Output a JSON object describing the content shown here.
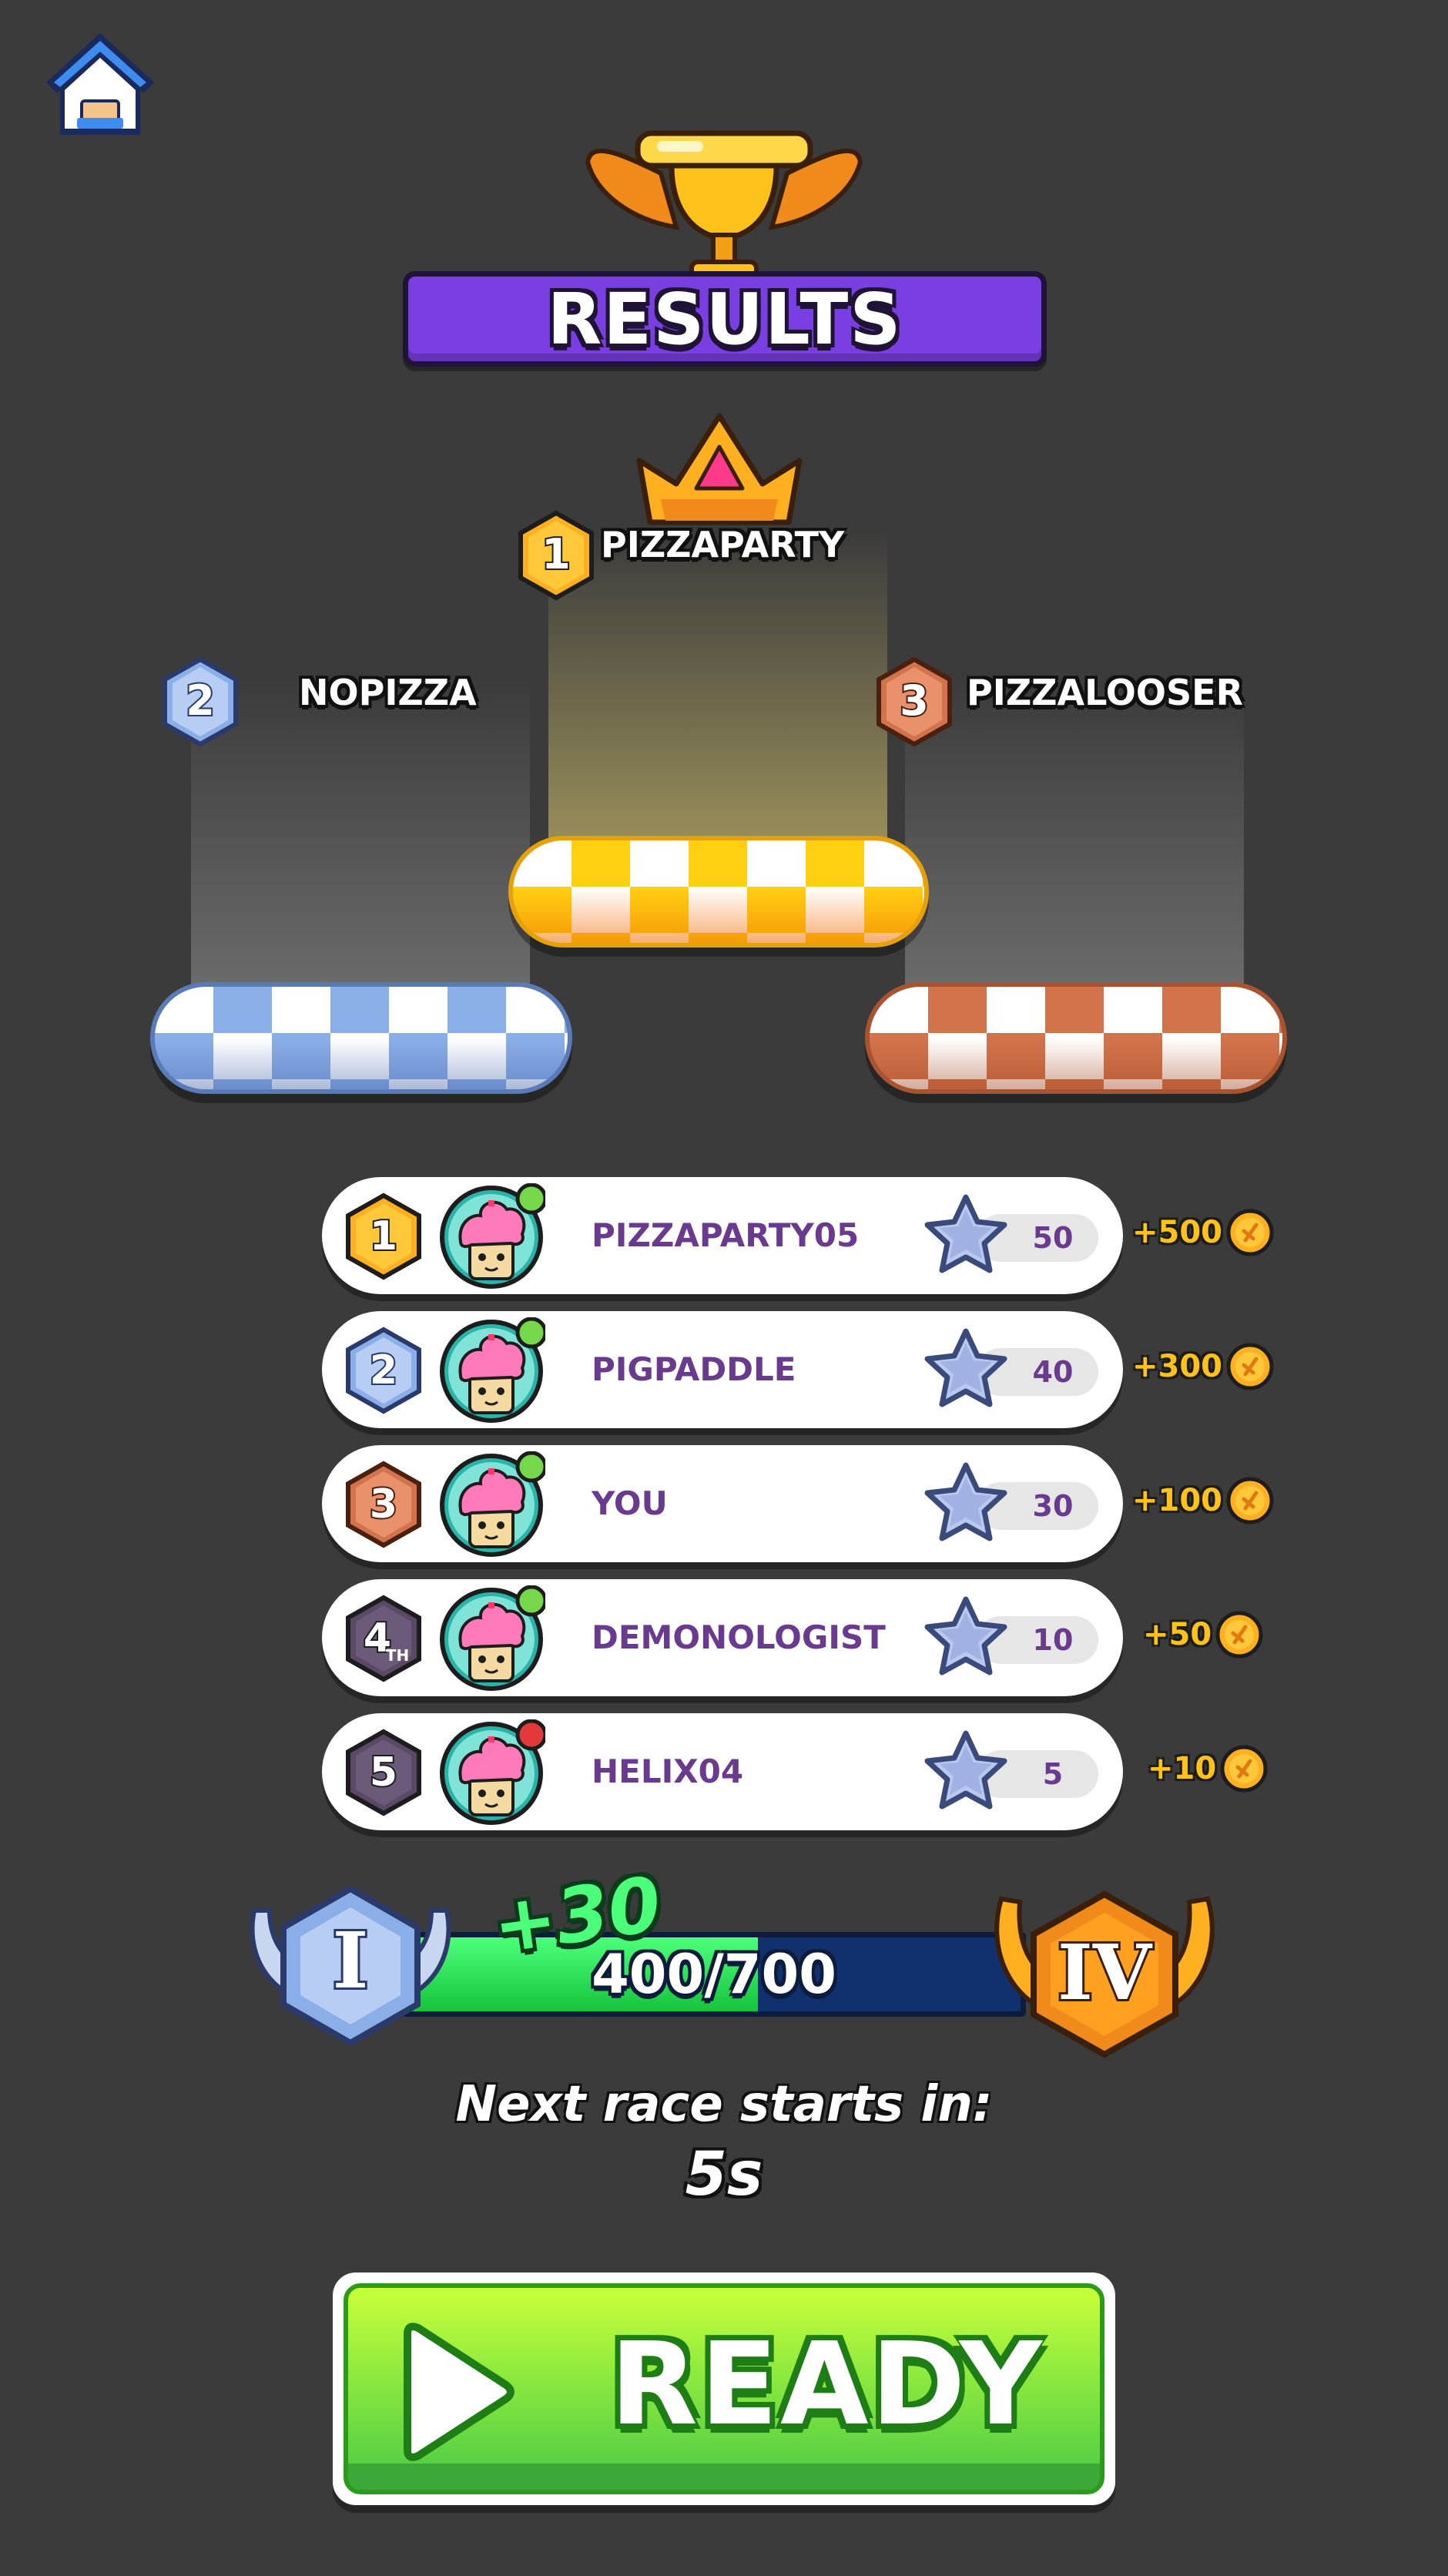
{
  "header": {
    "title": "RESULTS"
  },
  "podium": [
    {
      "place": "1",
      "name": "PIZZAPARTY"
    },
    {
      "place": "2",
      "name": "NOPIZZA"
    },
    {
      "place": "3",
      "name": "PIZZALOOSER"
    }
  ],
  "leaderboard": [
    {
      "rank": "1",
      "name": "PIZZAPARTY05",
      "stars": "50",
      "reward": "+500",
      "online": true
    },
    {
      "rank": "2",
      "name": "PIGPADDLE",
      "stars": "40",
      "reward": "+300",
      "online": true
    },
    {
      "rank": "3",
      "name": "YOU",
      "stars": "30",
      "reward": "+100",
      "online": true
    },
    {
      "rank": "4",
      "rank_suffix": "TH",
      "name": "DEMONOLOGIST",
      "stars": "10",
      "reward": "+50",
      "online": true
    },
    {
      "rank": "5",
      "name": "HELIX04",
      "stars": "5",
      "reward": "+10",
      "online": false
    }
  ],
  "xp": {
    "gain": "+30",
    "current": 400,
    "max": 700,
    "label": "400/700",
    "current_rank": "I",
    "next_rank": "IV"
  },
  "countdown": {
    "label": "Next race starts in:",
    "value": "5s"
  },
  "ready_button": {
    "label": "READY"
  },
  "colors": {
    "gold": "#ffb020",
    "silver": "#8aaee8",
    "bronze": "#d2734c",
    "gray": "#5a4a66",
    "purple": "#7a3fe0",
    "green": "#4cff7a"
  }
}
